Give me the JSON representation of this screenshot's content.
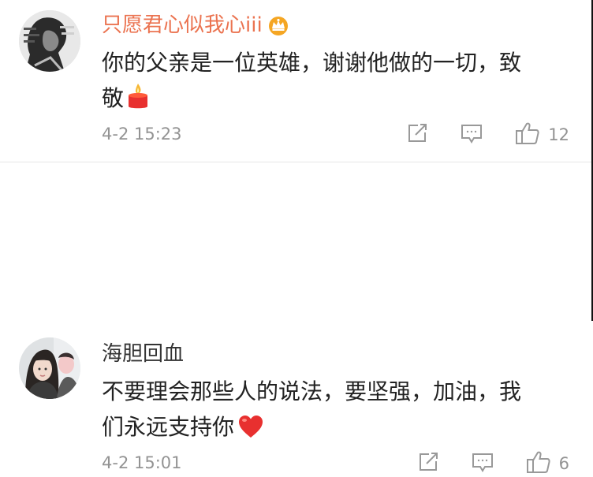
{
  "comments": [
    {
      "username": "只愿君心似我心iii",
      "badge_icon": "crown-icon",
      "text_line1": "你的父亲是一位英雄，谢谢他做的一切，致",
      "text_line2": "敬",
      "emoji": "candle-icon",
      "time": "4-2 15:23",
      "likes": "12",
      "avatar": "avatar-portrait-sketch"
    },
    {
      "username": "海胆回血",
      "text_line1": "不要理会那些人的说法，要坚强，加油，我",
      "text_line2": "们永远支持你",
      "emoji": "heart-icon",
      "time": "4-2 15:01",
      "likes": "6",
      "avatar": "avatar-girl-photo"
    }
  ],
  "icons": {
    "repost": "repost-icon",
    "reply": "reply-icon",
    "like": "thumbs-up-icon"
  },
  "colors": {
    "vip_name": "#eb7350",
    "meta": "#939393",
    "heart": "#e8302f"
  }
}
